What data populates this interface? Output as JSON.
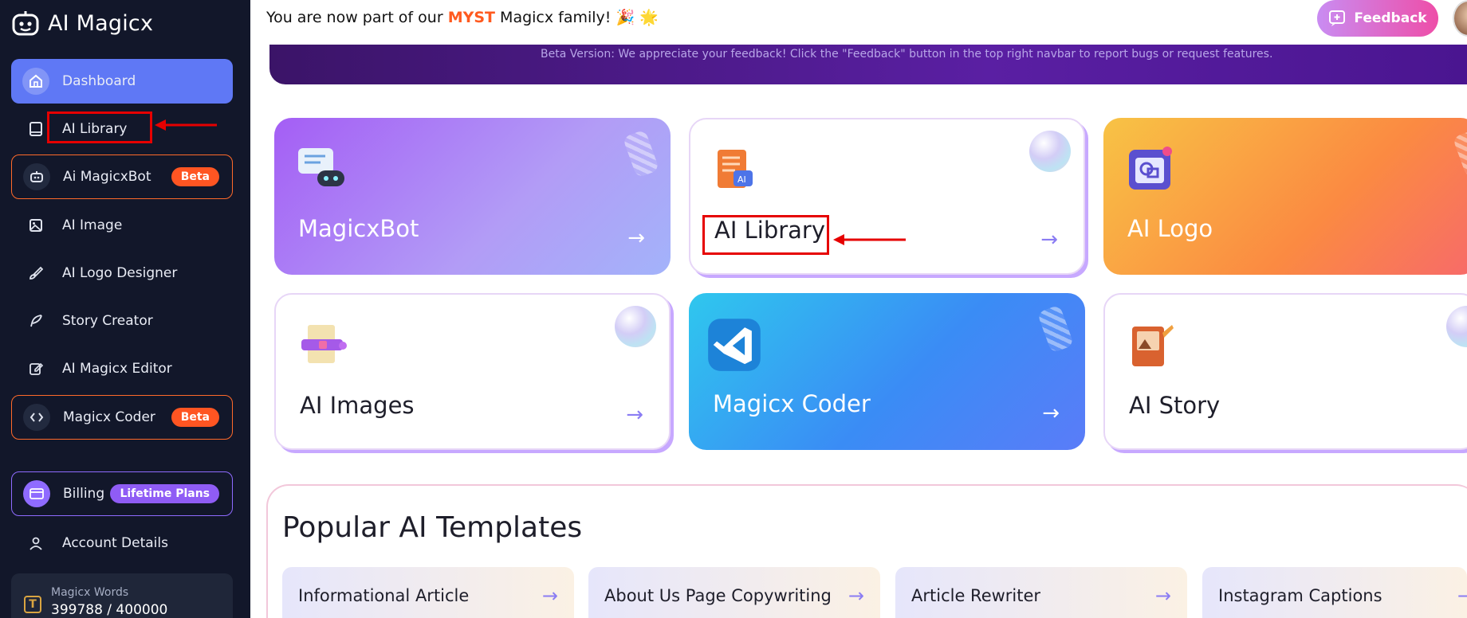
{
  "app": {
    "name": "AI Magicx"
  },
  "sidebar": {
    "items": [
      {
        "label": "Dashboard"
      },
      {
        "label": "AI Library"
      },
      {
        "label": "Ai MagicxBot",
        "badge": "Beta"
      },
      {
        "label": "AI Image"
      },
      {
        "label": "AI Logo Designer"
      },
      {
        "label": "Story Creator"
      },
      {
        "label": "AI Magicx Editor"
      },
      {
        "label": "Magicx Coder",
        "badge": "Beta"
      },
      {
        "label": "Billing",
        "badge": "Lifetime Plans"
      },
      {
        "label": "Account Details"
      }
    ],
    "words": {
      "label": "Magicx Words",
      "value": "399788 / 400000"
    }
  },
  "topbar": {
    "welcome_prefix": "You are now part of our",
    "welcome_highlight": "MYST",
    "welcome_suffix": "Magicx family! 🎉 🌟",
    "feedback_label": "Feedback"
  },
  "banner": {
    "text": "Beta Version: We appreciate your feedback! Click the \"Feedback\" button in the top right navbar to report bugs or request features."
  },
  "cards": [
    {
      "title": "MagicxBot"
    },
    {
      "title": "AI Library"
    },
    {
      "title": "AI Logo"
    },
    {
      "title": "AI Images"
    },
    {
      "title": "Magicx Coder"
    },
    {
      "title": "AI Story"
    }
  ],
  "popular": {
    "title": "Popular AI Templates",
    "templates": [
      {
        "label": "Informational Article"
      },
      {
        "label": "About Us Page Copywriting"
      },
      {
        "label": "Article Rewriter"
      },
      {
        "label": "Instagram Captions"
      }
    ]
  },
  "colors": {
    "sidebar_bg": "#12172a",
    "active_nav": "#5f78f5",
    "beta_badge": "#ff5522",
    "lifetime_badge": "#8f5cf5",
    "highlight_red": "#e60000",
    "myst_orange": "#ff5a1f"
  },
  "icons": [
    "robot-logo-icon",
    "home-icon",
    "book-icon",
    "bot-icon",
    "image-icon",
    "brush-icon",
    "feather-icon",
    "edit-icon",
    "code-icon",
    "credit-card-icon",
    "user-icon",
    "token-icon",
    "message-plus-icon",
    "arrow-right-icon"
  ]
}
